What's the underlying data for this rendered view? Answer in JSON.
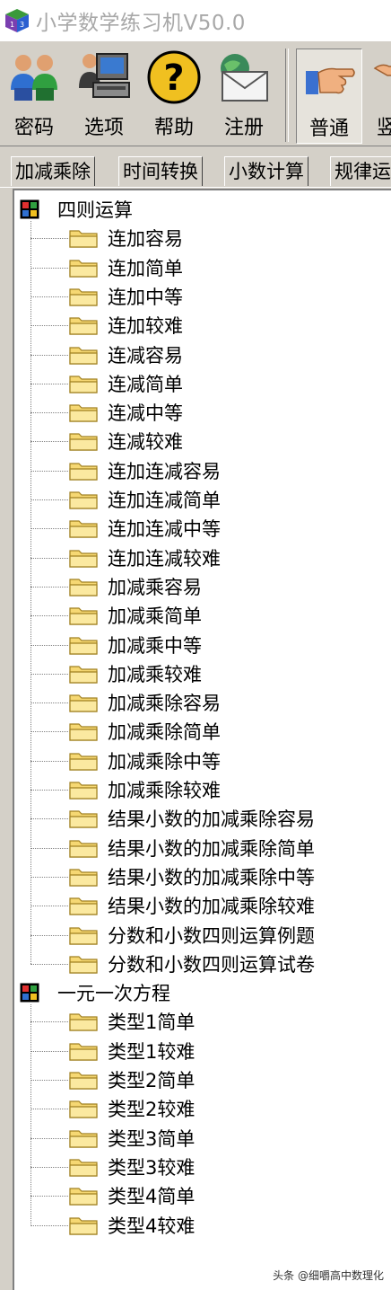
{
  "app": {
    "title": "小学数学练习机V50.0"
  },
  "toolbar": {
    "buttons": [
      {
        "label": "密码",
        "icon": "users-icon"
      },
      {
        "label": "选项",
        "icon": "computer-icon"
      },
      {
        "label": "帮助",
        "icon": "help-icon"
      },
      {
        "label": "注册",
        "icon": "mail-icon"
      },
      {
        "label": "普通",
        "icon": "hand-icon",
        "pressed": true
      },
      {
        "label": "竖",
        "icon": "hand-vertical-icon"
      }
    ]
  },
  "tabs": [
    "加减乘除",
    "时间转换",
    "小数计算",
    "规律运"
  ],
  "tree": [
    {
      "label": "四则运算",
      "children": [
        "连加容易",
        "连加简单",
        "连加中等",
        "连加较难",
        "连减容易",
        "连减简单",
        "连减中等",
        "连减较难",
        "连加连减容易",
        "连加连减简单",
        "连加连减中等",
        "连加连减较难",
        "加减乘容易",
        "加减乘简单",
        "加减乘中等",
        "加减乘较难",
        "加减乘除容易",
        "加减乘除简单",
        "加减乘除中等",
        "加减乘除较难",
        "结果小数的加减乘除容易",
        "结果小数的加减乘除简单",
        "结果小数的加减乘除中等",
        "结果小数的加减乘除较难",
        "分数和小数四则运算例题",
        "分数和小数四则运算试卷"
      ]
    },
    {
      "label": "一元一次方程",
      "children": [
        "类型1简单",
        "类型1较难",
        "类型2简单",
        "类型2较难",
        "类型3简单",
        "类型3较难",
        "类型4简单",
        "类型4较难"
      ]
    }
  ],
  "watermark": "头条 @细嚼高中数理化"
}
